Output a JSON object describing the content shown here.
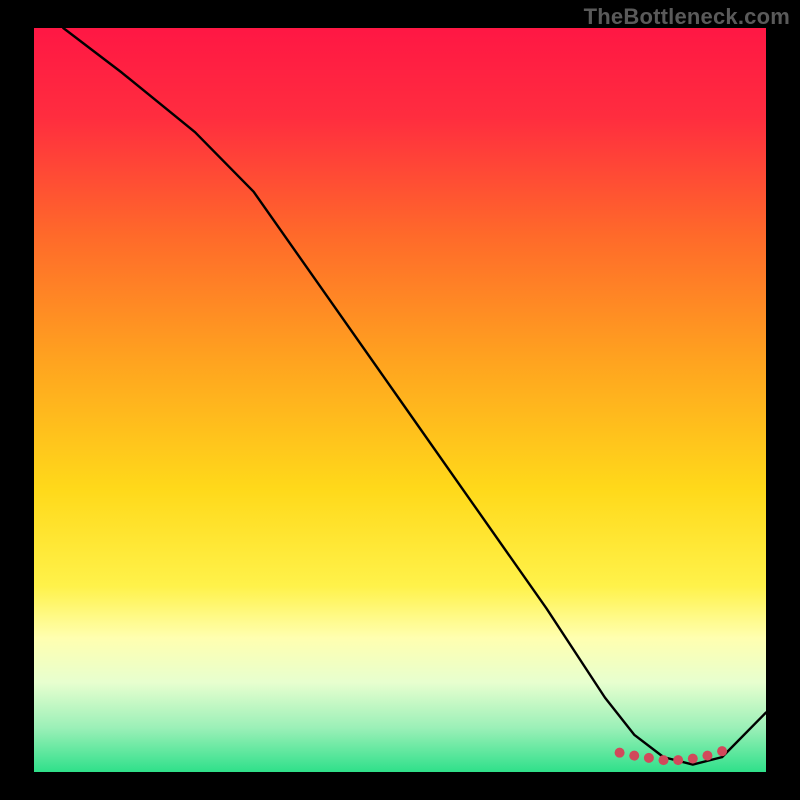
{
  "branding": {
    "watermark": "TheBottleneck.com"
  },
  "chart_data": {
    "type": "line",
    "title": "",
    "xlabel": "",
    "ylabel": "",
    "xlim": [
      0,
      100
    ],
    "ylim": [
      0,
      100
    ],
    "grid": false,
    "legend": false,
    "background_gradient_stops": [
      {
        "offset": 0.0,
        "color": "#ff1744"
      },
      {
        "offset": 0.12,
        "color": "#ff2d3f"
      },
      {
        "offset": 0.28,
        "color": "#ff6a2a"
      },
      {
        "offset": 0.45,
        "color": "#ffa41f"
      },
      {
        "offset": 0.62,
        "color": "#ffd91a"
      },
      {
        "offset": 0.75,
        "color": "#fff24a"
      },
      {
        "offset": 0.82,
        "color": "#ffffb0"
      },
      {
        "offset": 0.88,
        "color": "#e7ffcf"
      },
      {
        "offset": 0.94,
        "color": "#9cf0b8"
      },
      {
        "offset": 1.0,
        "color": "#2fe08a"
      }
    ],
    "series": [
      {
        "name": "curve",
        "color": "#000000",
        "stroke_width": 2.4,
        "x": [
          4,
          12,
          22,
          30,
          40,
          50,
          60,
          70,
          78,
          82,
          86,
          90,
          94,
          100
        ],
        "y": [
          100,
          94,
          86,
          78,
          64,
          50,
          36,
          22,
          10,
          5,
          2,
          1,
          2,
          8
        ]
      }
    ],
    "markers": {
      "name": "bottom-dots",
      "color": "#d1495b",
      "radius": 5,
      "x": [
        80,
        82,
        84,
        86,
        88,
        90,
        92,
        94
      ],
      "y": [
        2.6,
        2.2,
        1.9,
        1.6,
        1.6,
        1.8,
        2.2,
        2.8
      ]
    }
  }
}
